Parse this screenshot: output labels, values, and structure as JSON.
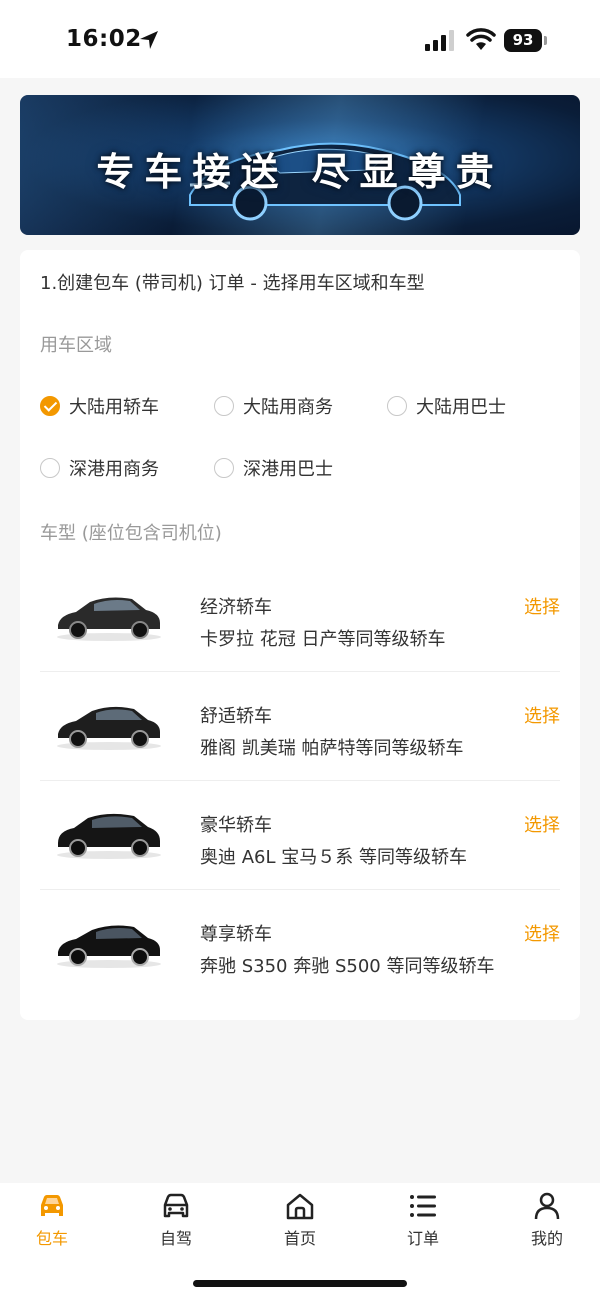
{
  "status_bar": {
    "time": "16:02",
    "battery": "93"
  },
  "banner": {
    "text": "专车接送 尽显尊贵"
  },
  "step_title": "1.创建包车 (带司机) 订单 - 选择用车区域和车型",
  "region": {
    "label": "用车区域",
    "options": [
      {
        "label": "大陆用轿车",
        "checked": true
      },
      {
        "label": "大陆用商务",
        "checked": false
      },
      {
        "label": "大陆用巴士",
        "checked": false
      },
      {
        "label": "深港用商务",
        "checked": false
      },
      {
        "label": "深港用巴士",
        "checked": false
      }
    ]
  },
  "car_type": {
    "label": "车型 (座位包含司机位)",
    "select_label": "选择",
    "items": [
      {
        "name": "经济轿车",
        "desc": "卡罗拉 花冠 日产等同等级轿车"
      },
      {
        "name": "舒适轿车",
        "desc": "雅阁 凯美瑞 帕萨特等同等级轿车"
      },
      {
        "name": "豪华轿车",
        "desc": "奥迪 A6L 宝马５系 等同等级轿车"
      },
      {
        "name": "尊享轿车",
        "desc": "奔驰 S350 奔驰 S500 等同等级轿车"
      }
    ]
  },
  "tabs": [
    {
      "label": "包车",
      "icon": "car-icon",
      "active": true
    },
    {
      "label": "自驾",
      "icon": "car-outline-icon",
      "active": false
    },
    {
      "label": "首页",
      "icon": "home-icon",
      "active": false
    },
    {
      "label": "订单",
      "icon": "list-icon",
      "active": false
    },
    {
      "label": "我的",
      "icon": "person-icon",
      "active": false
    }
  ],
  "colors": {
    "accent": "#f39800",
    "text": "#333333",
    "muted": "#999999"
  }
}
